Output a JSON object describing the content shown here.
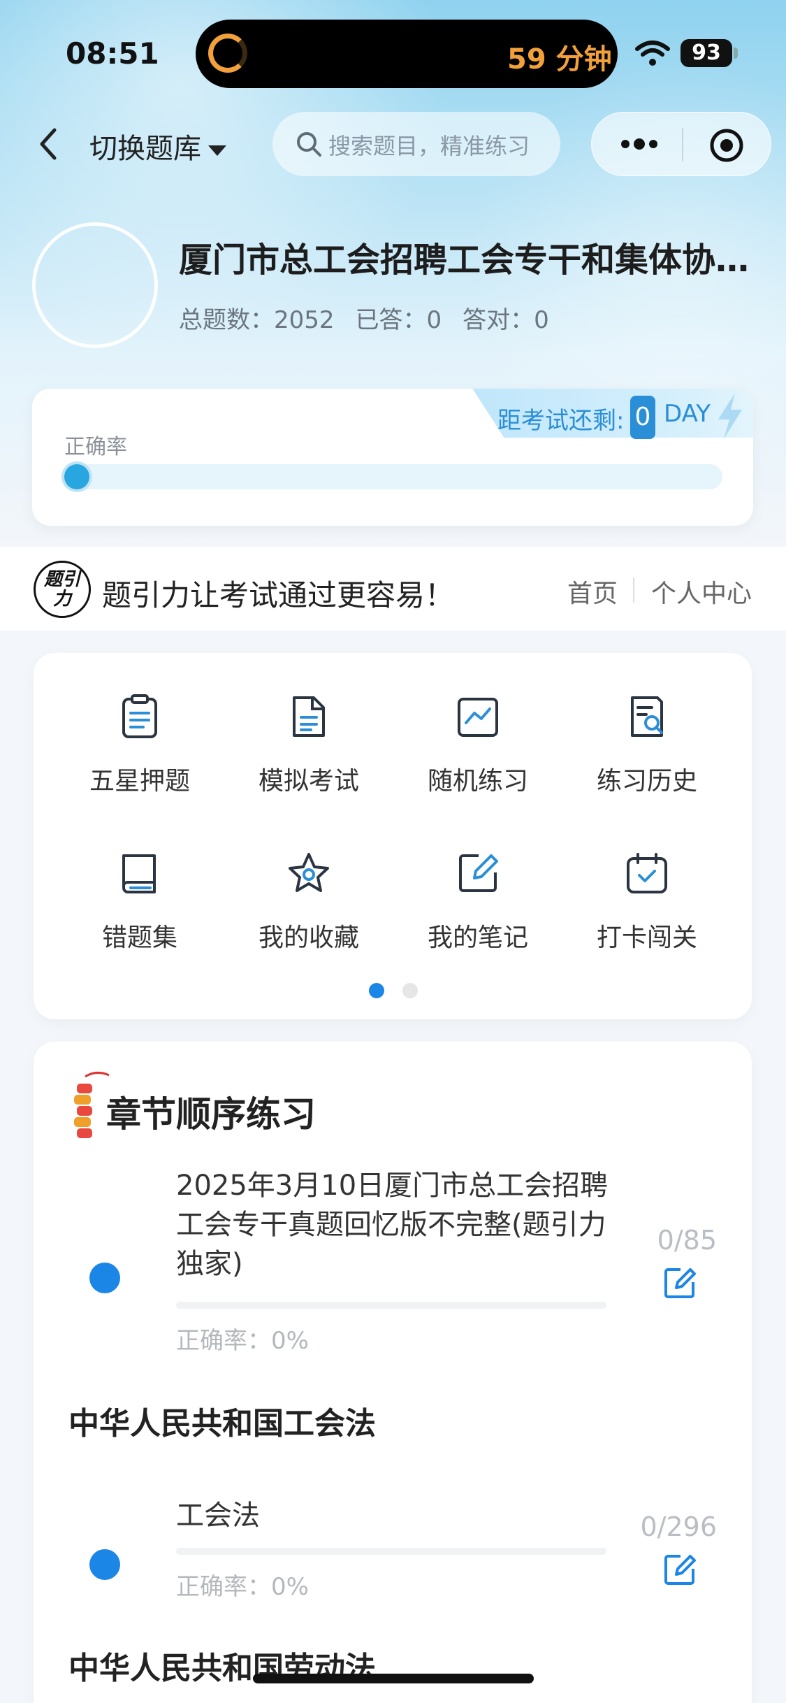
{
  "status_bar": {
    "time": "08:51",
    "activity": "59 分钟",
    "battery": "93"
  },
  "nav": {
    "switch_label": "切换题库",
    "search_placeholder": "搜索题目，精准练习"
  },
  "bank": {
    "title": "厦门市总工会招聘工会专干和集体协商...",
    "total_label": "总题数：2052",
    "answered_label": "已答：0",
    "correct_label": "答对：0"
  },
  "accuracy": {
    "label": "正确率",
    "value_fraction": 0,
    "countdown_label": "距考试还剩:",
    "countdown_days": "0",
    "countdown_unit": "DAY"
  },
  "banner": {
    "logo_text": "题引力",
    "slogan": "题引力让考试通过更容易！",
    "home_link": "首页",
    "user_link": "个人中心"
  },
  "features": [
    {
      "label": "五星押题",
      "icon": "clipboard-icon"
    },
    {
      "label": "模拟考试",
      "icon": "document-icon"
    },
    {
      "label": "随机练习",
      "icon": "chart-icon"
    },
    {
      "label": "练习历史",
      "icon": "search-doc-icon"
    },
    {
      "label": "错题集",
      "icon": "book-icon"
    },
    {
      "label": "我的收藏",
      "icon": "star-icon"
    },
    {
      "label": "我的笔记",
      "icon": "note-edit-icon"
    },
    {
      "label": "打卡闯关",
      "icon": "calendar-check-icon"
    }
  ],
  "pager": {
    "active_page": 1,
    "total_pages": 2
  },
  "chapters": {
    "title": "章节顺序练习",
    "items": [
      {
        "title": "2025年3月10日厦门市总工会招聘工会专干真题回忆版不完整(题引力独家)",
        "count": "0/85",
        "accuracy": "正确率：0%"
      }
    ],
    "sections": [
      {
        "heading": "中华人民共和国工会法",
        "items": [
          {
            "title": "工会法",
            "count": "0/296",
            "accuracy": "正确率：0%"
          }
        ]
      },
      {
        "heading": "中华人民共和国劳动法",
        "items": []
      }
    ]
  },
  "colors": {
    "accent": "#1c86e6",
    "progress": "#28a6e0",
    "countdown": "#2a8fd6",
    "activity": "#f2a13a"
  }
}
